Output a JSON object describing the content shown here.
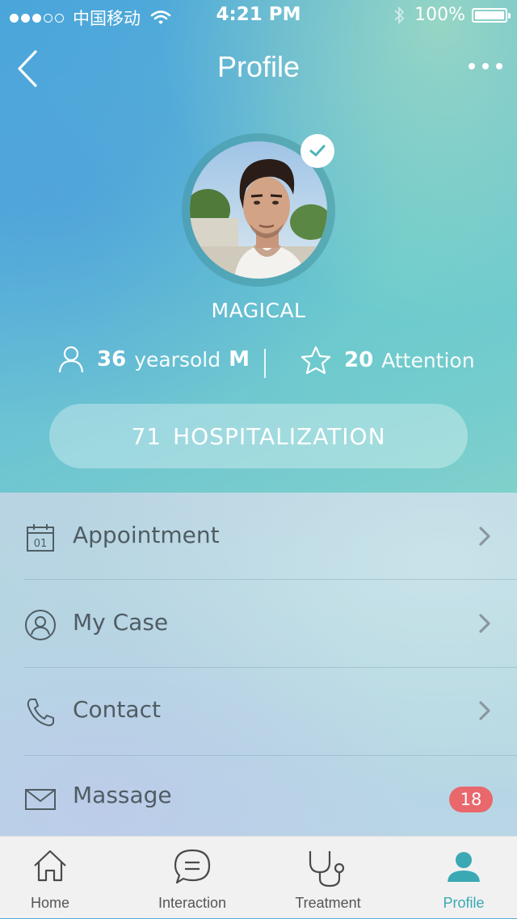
{
  "status_bar": {
    "signal_dots_filled": 3,
    "signal_dots_total": 5,
    "carrier": "中国移动",
    "time": "4:21 PM",
    "battery": "100%",
    "icons": [
      "wifi-icon",
      "bluetooth-icon",
      "battery-icon"
    ]
  },
  "nav": {
    "title": "Profile",
    "back_icon": "chevron-left-icon",
    "more_icon": "more-dots-icon"
  },
  "profile": {
    "name": "MAGICAL",
    "verified": true,
    "age": "36",
    "age_label": "yearsold",
    "sex": "M",
    "attention_count": "20",
    "attention_label": "Attention",
    "hospitalization_count": "71",
    "hospitalization_label": "HOSPITALIZATION"
  },
  "menu": [
    {
      "label": "Appointment",
      "icon": "calendar-icon",
      "calendar_day": "01"
    },
    {
      "label": "My Case",
      "icon": "user-circle-icon"
    },
    {
      "label": "Contact",
      "icon": "phone-icon"
    },
    {
      "label": "Massage",
      "icon": "mail-icon",
      "badge": "18"
    }
  ],
  "tabs": [
    {
      "label": "Home",
      "icon": "home-icon"
    },
    {
      "label": "Interaction",
      "icon": "chat-icon"
    },
    {
      "label": "Treatment",
      "icon": "stethoscope-icon"
    },
    {
      "label": "Profile",
      "icon": "profile-icon",
      "active": true
    }
  ],
  "colors": {
    "accent": "#3aa9b3",
    "badge": "#e8686c",
    "text_list": "#4f5d63"
  }
}
